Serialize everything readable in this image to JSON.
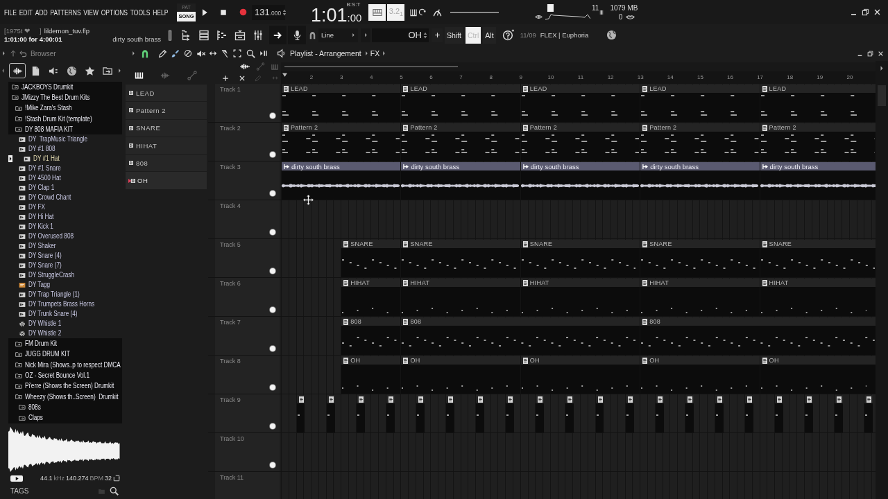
{
  "menu": [
    "FILE",
    "EDIT",
    "ADD",
    "PATTERNS",
    "VIEW",
    "OPTIONS",
    "TOOLS",
    "HELP"
  ],
  "transport": {
    "modes": [
      {
        "label": "PAT",
        "selected": false
      },
      {
        "label": "SONG",
        "selected": true
      }
    ],
    "tempo": "131",
    "tempo_fraction": ".000",
    "time": "1:01",
    "time_ticks": ":00",
    "time_format": "B:S:T",
    "countdown": "3.2$_{1}$"
  },
  "monitor": {
    "voices": "11",
    "memory": "1079 MB",
    "polyphony": "0"
  },
  "hint_bar": {
    "prefix": "[1975t ❤",
    "suffix": "]",
    "project_file": "lildemon_tuv.flp",
    "song_position": "1:01:00 for 4:00:01",
    "current_sample": "dirty south brass"
  },
  "toolbar": {
    "snap": "Line",
    "pattern": "OH",
    "keys": [
      {
        "label": "Shift",
        "pressed": false
      },
      {
        "label": "Ctrl",
        "pressed": true
      },
      {
        "label": "Alt",
        "pressed": false
      }
    ],
    "news_date": "11/09",
    "news": "FLEX | Euphoria"
  },
  "browser": {
    "title": "Browser",
    "tabs": [
      {
        "kind": "all",
        "selected": true
      },
      {
        "kind": "files",
        "selected": false
      },
      {
        "kind": "plugins",
        "selected": false
      },
      {
        "kind": "online",
        "selected": false
      },
      {
        "kind": "favorites",
        "selected": false
      },
      {
        "kind": "recent",
        "selected": false
      }
    ],
    "tree": [
      {
        "kind": "folder",
        "label": "JACKBOYS Drumkit",
        "selected": false
      },
      {
        "kind": "folder",
        "label": "JMizzy The Best Drum Kits",
        "selected": false,
        "children": [
          {
            "kind": "folder",
            "label": "!Mike Zara's Stash",
            "selected": false
          },
          {
            "kind": "folder",
            "label": "!Stash Drum Kit (template)",
            "selected": false
          },
          {
            "kind": "folder",
            "label": "DY 808 MAFIA KIT",
            "selected": false,
            "children": [
              {
                "kind": "sample",
                "label": "DY  TrapMusic Triangle",
                "selected": false
              },
              {
                "kind": "sample",
                "label": "DY #1 808",
                "selected": false
              },
              {
                "kind": "sample",
                "label": "DY #1 Hat",
                "selected": true
              },
              {
                "kind": "sample",
                "label": "DY #1 Snare",
                "selected": false
              },
              {
                "kind": "sample",
                "label": "DY 4500 Hat",
                "selected": false
              },
              {
                "kind": "sample",
                "label": "DY Clap 1",
                "selected": false
              },
              {
                "kind": "sample",
                "label": "DY Crowd Chant",
                "selected": false
              },
              {
                "kind": "sample",
                "label": "DY FX",
                "selected": false
              },
              {
                "kind": "sample",
                "label": "DY Hi Hat",
                "selected": false
              },
              {
                "kind": "sample",
                "label": "DY Kick 1",
                "selected": false
              },
              {
                "kind": "sample",
                "label": "DY Overused 808",
                "selected": false
              },
              {
                "kind": "sample",
                "label": "DY Shaker",
                "selected": false
              },
              {
                "kind": "sample",
                "label": "DY Snare (4)",
                "selected": false
              },
              {
                "kind": "sample",
                "label": "DY Snare (7)",
                "selected": false
              },
              {
                "kind": "sample",
                "label": "DY StruggleCrash",
                "selected": false
              },
              {
                "kind": "mp3",
                "label": "DY Tagg",
                "selected": false
              },
              {
                "kind": "sample",
                "label": "DY Trap Triangle (1)",
                "selected": false
              },
              {
                "kind": "sample",
                "label": "DY Trumpets Brass Horns",
                "selected": false
              },
              {
                "kind": "sample",
                "label": "DY Trunk Snare (4)",
                "selected": false
              },
              {
                "kind": "preset",
                "label": "DY Whistle 1",
                "selected": false
              },
              {
                "kind": "preset",
                "label": "DY Whistle 2",
                "selected": false
              }
            ]
          },
          {
            "kind": "folder",
            "label": "FM Drum Kit",
            "selected": false
          },
          {
            "kind": "folder",
            "label": "JUGG DRUM KIT",
            "selected": false
          },
          {
            "kind": "folder",
            "label": "Nick Mira (Shows..p to respect DMCA",
            "selected": false
          },
          {
            "kind": "folder",
            "label": "OZ - Secret Bounce Vol.1",
            "selected": false
          },
          {
            "kind": "folder",
            "label": "Pi'erre (Shows the Screen) Drumkit",
            "selected": false
          },
          {
            "kind": "folder",
            "label": "Wheezy (Shows th..Screen)  Drumkit",
            "selected": false,
            "children": [
              {
                "kind": "folder",
                "label": "808s",
                "selected": false
              },
              {
                "kind": "folder",
                "label": "Claps",
                "selected": false
              }
            ]
          }
        ]
      }
    ],
    "preview": {
      "info": [
        {
          "value": "44.1",
          "unit": "kHz"
        },
        {
          "value": "140.274",
          "unit": "BPM"
        },
        {
          "value": "32"
        }
      ]
    },
    "footer": "TAGS"
  },
  "patterns": [
    {
      "label": "LEAD",
      "selected": false
    },
    {
      "label": "Pattern 2",
      "selected": false
    },
    {
      "label": "SNARE",
      "selected": false
    },
    {
      "label": "HIHAT",
      "selected": false
    },
    {
      "label": "808",
      "selected": false
    },
    {
      "label": "OH",
      "selected": true
    }
  ],
  "playlist": {
    "title": "Playlist - Arrangement",
    "crumb": "FX",
    "ruler": [
      "2",
      "3",
      "4",
      "5",
      "6",
      "7",
      "8",
      "9",
      "10",
      "11",
      "12",
      "13",
      "14",
      "15",
      "16",
      "17",
      "18",
      "19",
      "20"
    ],
    "tracks": [
      {
        "name": "Track 1",
        "enabled": true,
        "clips": [
          {
            "kind": "pattern",
            "label": "LEAD"
          },
          {
            "kind": "pattern",
            "label": "LEAD"
          },
          {
            "kind": "pattern",
            "label": "LEAD"
          },
          {
            "kind": "pattern",
            "label": "LEAD"
          },
          {
            "kind": "pattern",
            "label": "LEAD"
          }
        ]
      },
      {
        "name": "Track 2",
        "enabled": true,
        "clips": [
          {
            "kind": "pattern",
            "label": "Pattern 2"
          },
          {
            "kind": "pattern",
            "label": "Pattern 2"
          },
          {
            "kind": "pattern",
            "label": "Pattern 2"
          },
          {
            "kind": "pattern",
            "label": "Pattern 2"
          },
          {
            "kind": "pattern",
            "label": "Pattern 2"
          }
        ]
      },
      {
        "name": "Track 3",
        "enabled": true,
        "clips": [
          {
            "kind": "audio",
            "label": "dirty south brass"
          },
          {
            "kind": "audio",
            "label": "dirty south brass"
          },
          {
            "kind": "audio",
            "label": "dirty south brass"
          },
          {
            "kind": "audio",
            "label": "dirty south brass"
          },
          {
            "kind": "audio",
            "label": "dirty south brass"
          }
        ]
      },
      {
        "name": "Track 4",
        "enabled": true
      },
      {
        "name": "Track 5",
        "enabled": true,
        "clips": [
          {
            "kind": "pattern",
            "label": "SNARE"
          },
          {
            "kind": "pattern",
            "label": "SNARE"
          },
          {
            "kind": "pattern",
            "label": "SNARE"
          },
          {
            "kind": "pattern",
            "label": "SNARE"
          },
          {
            "kind": "pattern",
            "label": "SNARE"
          }
        ]
      },
      {
        "name": "Track 6",
        "enabled": true,
        "clips": [
          {
            "kind": "pattern",
            "label": "HIHAT"
          },
          {
            "kind": "pattern",
            "label": "HIHAT"
          },
          {
            "kind": "pattern",
            "label": "HIHAT"
          },
          {
            "kind": "pattern",
            "label": "HIHAT"
          },
          {
            "kind": "pattern",
            "label": "HIHAT"
          }
        ]
      },
      {
        "name": "Track 7",
        "enabled": true,
        "clips": [
          {
            "kind": "pattern",
            "label": "808"
          },
          {
            "kind": "pattern",
            "label": "808"
          },
          {
            "kind": "pattern",
            "label": "808"
          }
        ]
      },
      {
        "name": "Track 8",
        "enabled": true,
        "clips": [
          {
            "kind": "pattern",
            "label": "OH"
          },
          {
            "kind": "pattern",
            "label": "OH"
          },
          {
            "kind": "pattern",
            "label": "OH"
          },
          {
            "kind": "pattern",
            "label": "OH"
          },
          {
            "kind": "pattern",
            "label": "OH"
          }
        ]
      },
      {
        "name": "Track 9",
        "enabled": true,
        "clips": [
          {
            "kind": "pattern"
          },
          {
            "kind": "pattern"
          },
          {
            "kind": "pattern"
          },
          {
            "kind": "pattern"
          },
          {
            "kind": "pattern"
          },
          {
            "kind": "pattern"
          },
          {
            "kind": "pattern"
          },
          {
            "kind": "pattern"
          },
          {
            "kind": "pattern"
          },
          {
            "kind": "pattern"
          },
          {
            "kind": "pattern"
          },
          {
            "kind": "pattern"
          },
          {
            "kind": "pattern"
          },
          {
            "kind": "pattern"
          },
          {
            "kind": "pattern"
          },
          {
            "kind": "pattern"
          },
          {
            "kind": "pattern"
          },
          {
            "kind": "pattern"
          },
          {
            "kind": "pattern"
          },
          {
            "kind": "pattern"
          }
        ]
      },
      {
        "name": "Track 10",
        "enabled": true
      },
      {
        "name": "Track 11"
      }
    ]
  }
}
